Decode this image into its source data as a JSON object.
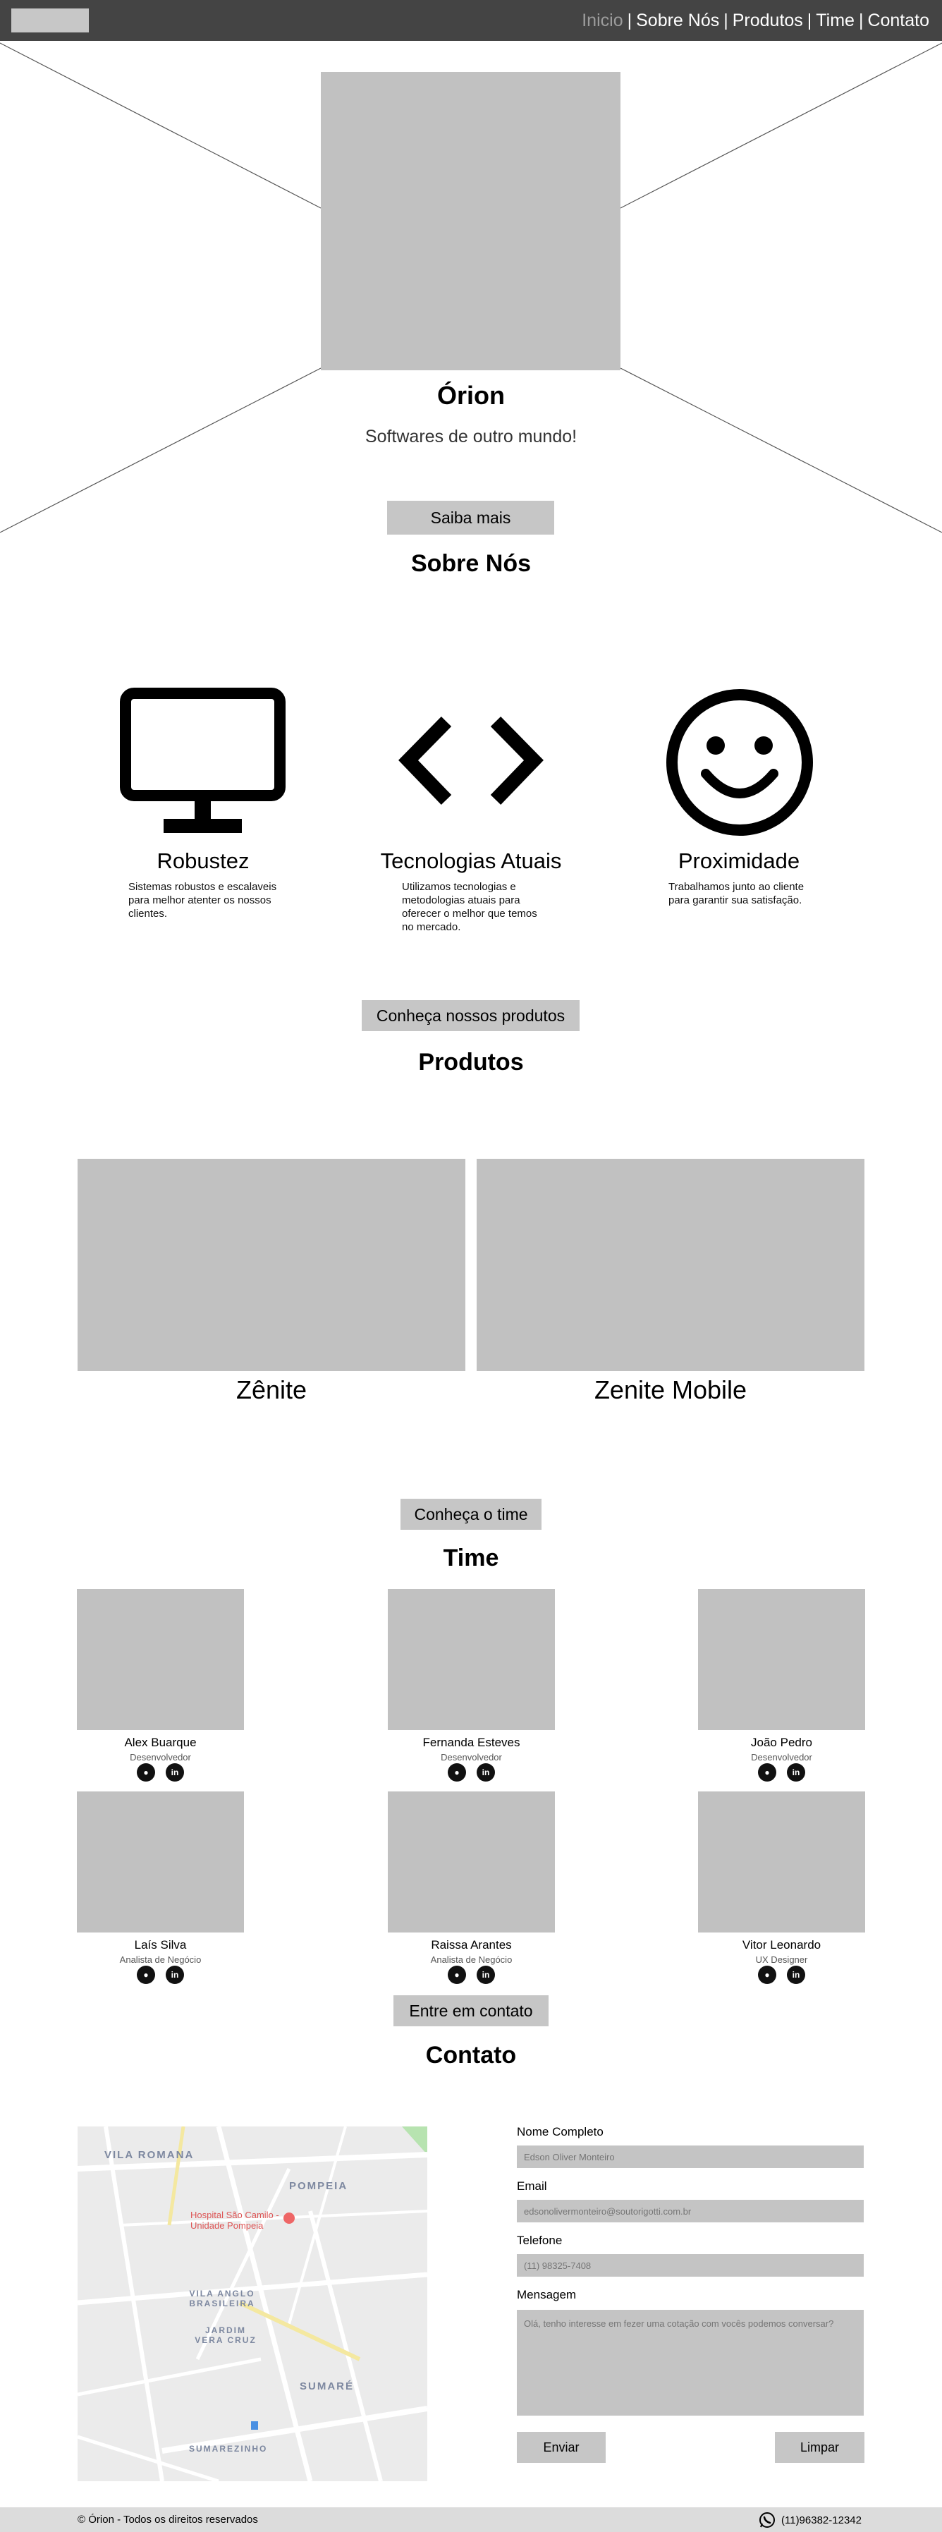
{
  "nav": {
    "items": [
      {
        "label": "Inicio",
        "active": true
      },
      {
        "label": "Sobre Nós",
        "active": false
      },
      {
        "label": "Produtos",
        "active": false
      },
      {
        "label": "Time",
        "active": false
      },
      {
        "label": "Contato",
        "active": false
      }
    ],
    "separator": "|"
  },
  "hero": {
    "title": "Órion",
    "tagline": "Softwares de outro mundo!",
    "button_label": "Saiba mais"
  },
  "about": {
    "title": "Sobre Nós",
    "features": [
      {
        "icon": "monitor-icon",
        "title": "Robustez",
        "description": "Sistemas robustos e escalaveis para melhor atenter os nossos clientes."
      },
      {
        "icon": "code-icon",
        "title": "Tecnologias Atuais",
        "description": "Utilizamos tecnologias e metodologias atuais para oferecer o melhor que temos no mercado."
      },
      {
        "icon": "smiley-icon",
        "title": "Proximidade",
        "description": "Trabalhamos junto ao cliente para garantir sua satisfação."
      }
    ],
    "button_label": "Conheça nossos produtos"
  },
  "products": {
    "title": "Produtos",
    "items": [
      {
        "name": "Zênite"
      },
      {
        "name": "Zenite Mobile"
      }
    ],
    "button_label": "Conheça o time"
  },
  "team": {
    "title": "Time",
    "members": [
      {
        "name": "Alex Buarque",
        "role": "Desenvolvedor"
      },
      {
        "name": "Fernanda Esteves",
        "role": "Desenvolvedor"
      },
      {
        "name": "João Pedro",
        "role": "Desenvolvedor"
      },
      {
        "name": "Laís Silva",
        "role": "Analista de Negócio"
      },
      {
        "name": "Raissa Arantes",
        "role": "Analista de Negócio"
      },
      {
        "name": "Vitor Leonardo",
        "role": "UX Designer"
      }
    ],
    "social_icons": [
      "github-icon",
      "linkedin-icon"
    ],
    "button_label": "Entre em contato"
  },
  "contact": {
    "title": "Contato",
    "map": {
      "labels": [
        "VILA ROMANA",
        "POMPEIA",
        "VILA ANGLO BRASILEIRA",
        "JARDIM VERA CRUZ",
        "SUMARÉ",
        "SUMAREZINHO"
      ],
      "poi": "Hospital São Camilo - Unidade Pompeia"
    },
    "form": {
      "name_label": "Nome Completo",
      "name_placeholder": "Edson Oliver Monteiro",
      "email_label": "Email",
      "email_placeholder": "edsonolivermonteiro@soutorigotti.com.br",
      "phone_label": "Telefone",
      "phone_placeholder": "(11) 98325-7408",
      "message_label": "Mensagem",
      "message_placeholder": "Olá, tenho interesse em fezer uma cotação com vocês podemos conversar?",
      "submit_label": "Enviar",
      "clear_label": "Limpar"
    }
  },
  "footer": {
    "copyright_symbol": "©",
    "copyright": "Órion - Todos os direitos reservados",
    "phone": "(11)96382-12342",
    "phone_icon": "whatsapp-icon"
  },
  "colors": {
    "nav_bg": "#444444",
    "placeholder_gray": "#c1c1c1",
    "button_gray": "#c6c6c6",
    "footer_bg": "#dcdcdc",
    "active_nav": "#9c9c9c"
  }
}
